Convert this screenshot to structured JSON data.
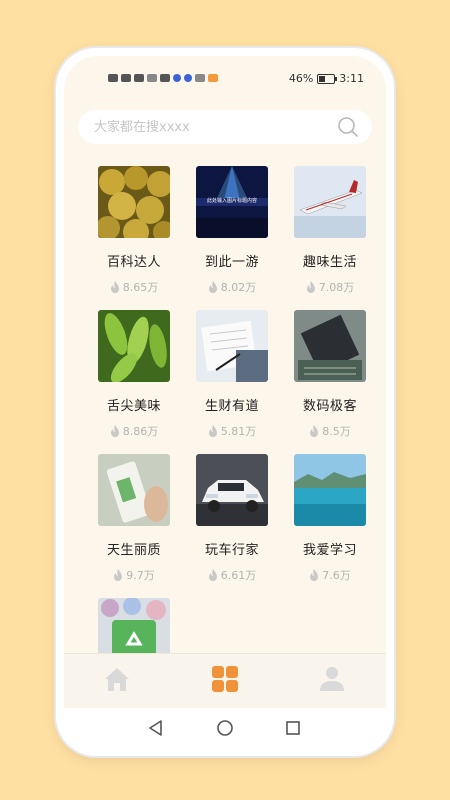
{
  "status_bar": {
    "battery_text": "46%",
    "battery_level": 0.46,
    "time": "3:11"
  },
  "search": {
    "placeholder": "大家都在搜xxxx",
    "icon": "search-icon"
  },
  "categories": [
    {
      "title": "百科达人",
      "heat": "8.65万",
      "image": "durian-photo"
    },
    {
      "title": "到此一游",
      "heat": "8.02万",
      "image": "aurora-banner",
      "image_text": "此处输入图片标题内容"
    },
    {
      "title": "趣味生活",
      "heat": "7.08万",
      "image": "airplane-photo"
    },
    {
      "title": "舌尖美味",
      "heat": "8.86万",
      "image": "edamame-photo"
    },
    {
      "title": "生财有道",
      "heat": "5.81万",
      "image": "business-paper-photo"
    },
    {
      "title": "数码极客",
      "heat": "8.5万",
      "image": "chip-photo"
    },
    {
      "title": "天生丽质",
      "heat": "9.7万",
      "image": "cosmetic-bottle-photo"
    },
    {
      "title": "玩车行家",
      "heat": "6.61万",
      "image": "white-suv-photo"
    },
    {
      "title": "我爱学习",
      "heat": "7.6万",
      "image": "seascape-photo"
    },
    {
      "title": "",
      "heat": "",
      "image": "recycle-bags-photo"
    }
  ],
  "tabbar": {
    "items": [
      {
        "icon": "home-icon",
        "active": false
      },
      {
        "icon": "grid-icon",
        "active": true
      },
      {
        "icon": "profile-icon",
        "active": false
      }
    ],
    "active_color": "#F0923A",
    "inactive_color": "#D9D9D9"
  },
  "navbar": {
    "items": [
      "back-icon",
      "home-circle-icon",
      "recents-icon"
    ]
  }
}
